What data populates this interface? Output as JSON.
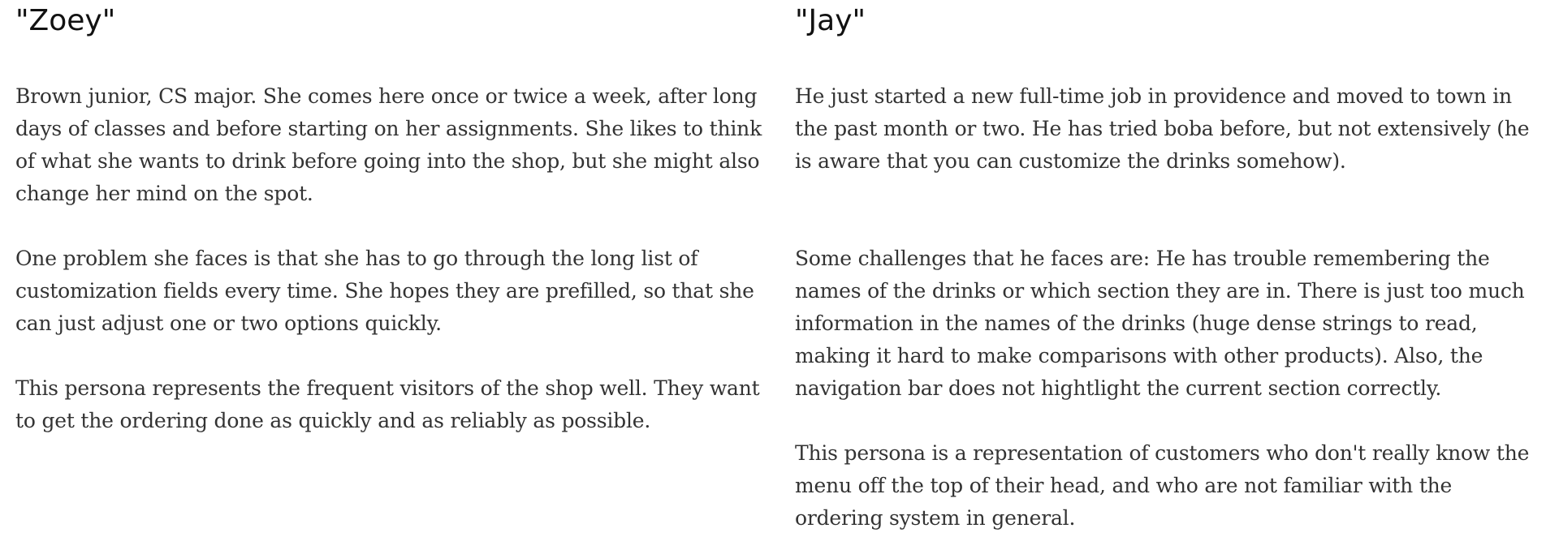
{
  "personas": [
    {
      "name": "\"Zoey\"",
      "paragraphs": [
        "Brown junior, CS major. She comes here once or twice a week, after long days of classes and before starting on her assignments. She likes to think of what she wants to drink before going into the shop, but she might also change her mind on the spot.",
        "One problem she faces is that she has to go through the long list of customization fields every time. She hopes they are prefilled, so that she can just adjust one or two options quickly.",
        "This persona represents the frequent visitors of the shop well. They want to get the ordering done as quickly and as reliably as possible."
      ]
    },
    {
      "name": "\"Jay\"",
      "paragraphs": [
        "He just started a new full-time job in providence and moved to town in the past month or two. He has tried boba before, but not extensively (he is aware that you can customize the drinks somehow).",
        "Some challenges that he faces are: He has trouble remembering the names of the drinks or which section they are in. There is just too much information in the names of the drinks (huge dense strings to read, making it hard to make comparisons with other products). Also, the navigation bar does not hightlight the current section correctly.",
        "This persona is a representation of customers who don't really know the menu off the top of their head, and who are not familiar with the ordering system in general."
      ]
    }
  ]
}
